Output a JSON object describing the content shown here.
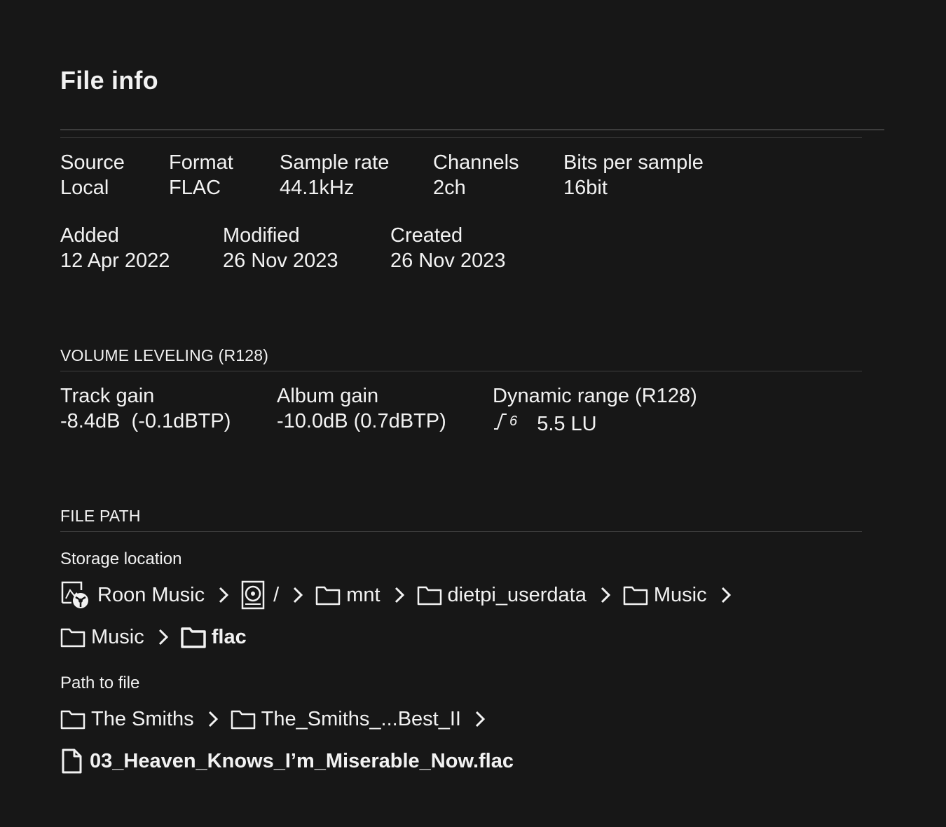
{
  "title": "File info",
  "info": {
    "source": {
      "label": "Source",
      "value": "Local"
    },
    "format": {
      "label": "Format",
      "value": "FLAC"
    },
    "sample_rate": {
      "label": "Sample rate",
      "value": "44.1kHz"
    },
    "channels": {
      "label": "Channels",
      "value": "2ch"
    },
    "bits": {
      "label": "Bits per sample",
      "value": "16bit"
    },
    "added": {
      "label": "Added",
      "value": "12 Apr 2022"
    },
    "modified": {
      "label": "Modified",
      "value": "26 Nov 2023"
    },
    "created": {
      "label": "Created",
      "value": "26 Nov 2023"
    }
  },
  "volume": {
    "heading": "VOLUME LEVELING (R128)",
    "track_gain": {
      "label": "Track gain",
      "value": "-8.4dB  (-0.1dBTP)"
    },
    "album_gain": {
      "label": "Album gain",
      "value": "-10.0dB (0.7dBTP)"
    },
    "dynamic_range": {
      "label": "Dynamic range (R128)",
      "icon_digit": "6",
      "value": "5.5 LU",
      "icon": "dynamic-range-icon"
    }
  },
  "file_path": {
    "heading": "FILE PATH",
    "storage_label": "Storage location",
    "storage": [
      {
        "icon": "roon-storage-icon",
        "label": "Roon Music"
      },
      {
        "icon": "drive-icon",
        "label": "/"
      },
      {
        "icon": "folder-icon",
        "label": "mnt"
      },
      {
        "icon": "folder-icon",
        "label": "dietpi_userdata"
      },
      {
        "icon": "folder-icon",
        "label": "Music"
      },
      {
        "icon": "folder-icon",
        "label": "Music"
      },
      {
        "icon": "folder-icon",
        "label": "flac"
      }
    ],
    "path_label": "Path to file",
    "path": [
      {
        "icon": "folder-icon",
        "label": "The Smiths"
      },
      {
        "icon": "folder-icon",
        "label": "The_Smiths_...Best_II"
      }
    ],
    "file": {
      "icon": "file-icon",
      "label": "03_Heaven_Knows_I’m_Miserable_Now.flac"
    }
  }
}
